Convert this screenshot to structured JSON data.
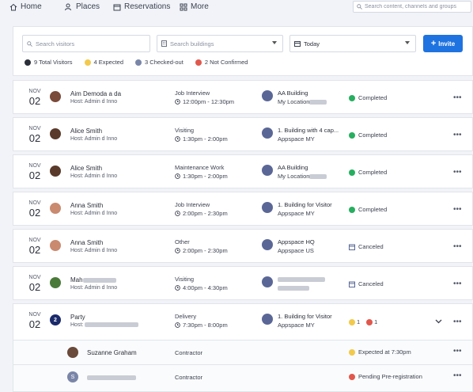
{
  "nav": {
    "items": [
      {
        "label": "Home",
        "icon": "home-icon"
      },
      {
        "label": "Places",
        "icon": "people-icon"
      },
      {
        "label": "Reservations",
        "icon": "calendar-icon"
      },
      {
        "label": "More",
        "icon": "grid-icon"
      }
    ],
    "search_placeholder": "Search content, channels and groups"
  },
  "filters": {
    "visitors_placeholder": "Search visitors",
    "buildings_placeholder": "Search buildings",
    "date_value": "Today",
    "invite_label": "Invite"
  },
  "stats": [
    {
      "label": "9 Total Visitors",
      "color": "#2b2f3a"
    },
    {
      "label": "4 Expected",
      "color": "#f2c94c"
    },
    {
      "label": "3 Checked-out",
      "color": "#7a86a8"
    },
    {
      "label": "2 Not Confirmed",
      "color": "#e2574c"
    }
  ],
  "visits": [
    {
      "month": "NOV",
      "day": "02",
      "name": "Aim Demoda a da",
      "host": "Host: Admin d Inno",
      "type": "Job Interview",
      "time": "12:00pm - 12:30pm",
      "building": "AA Building",
      "location": "My Location",
      "status": "Completed",
      "avatar_color": "#7a4a3a"
    },
    {
      "month": "NOV",
      "day": "02",
      "name": "Alice Smith",
      "host": "Host: Admin d Inno",
      "type": "Visiting",
      "time": "1:30pm - 2:00pm",
      "building": "1. Building with 4 cap...",
      "location": "Appspace MY",
      "status": "Completed",
      "avatar_color": "#5a3a2a"
    },
    {
      "month": "NOV",
      "day": "02",
      "name": "Alice Smith",
      "host": "Host: Admin d Inno",
      "type": "Maintenance Work",
      "time": "1:30pm - 2:00pm",
      "building": "AA Building",
      "location": "My Location",
      "status": "Completed",
      "avatar_color": "#5a3a2a"
    },
    {
      "month": "NOV",
      "day": "02",
      "name": "Anna Smith",
      "host": "Host: Admin d Inno",
      "type": "Job Interview",
      "time": "2:00pm - 2:30pm",
      "building": "1. Building for Visitor",
      "location": "Appspace MY",
      "status": "Completed",
      "avatar_color": "#c98a70"
    },
    {
      "month": "NOV",
      "day": "02",
      "name": "Anna Smith",
      "host": "Host: Admin d Inno",
      "type": "Other",
      "time": "2:00pm - 2:30pm",
      "building": "Appspace HQ",
      "location": "Appspace US",
      "status": "Canceled",
      "avatar_color": "#c98a70"
    },
    {
      "month": "NOV",
      "day": "02",
      "name": "Mah",
      "host": "Host: Admin d Inno",
      "type": "Visiting",
      "time": "4:00pm - 4:30pm",
      "building": "",
      "location": "",
      "status": "Canceled",
      "avatar_color": "#4a7a3a"
    },
    {
      "month": "NOV",
      "day": "02",
      "name": "Party",
      "host": "Host:",
      "type": "Delivery",
      "time": "7:30pm - 8:00pm",
      "building": "1. Building for Visitor",
      "location": "Appspace MY",
      "status": "",
      "avatar_color": "#1a2a6a",
      "avatar_text": "2",
      "expected_count": "1",
      "unconfirmed_count": "1"
    }
  ],
  "party_members": [
    {
      "name": "Suzanne Graham",
      "role": "Contractor",
      "status": "Expected at 7:30pm",
      "avatar_color": "#6a4a3a"
    },
    {
      "name": "",
      "role": "Contractor",
      "status": "Pending Pre-registration",
      "avatar_color": "#7a86a8",
      "avatar_text": "S"
    }
  ],
  "colors": {
    "completed": "#27ae60",
    "canceled": "#5a6796",
    "expected": "#f2c94c",
    "pending": "#e2574c",
    "accent": "#1f73e0"
  }
}
